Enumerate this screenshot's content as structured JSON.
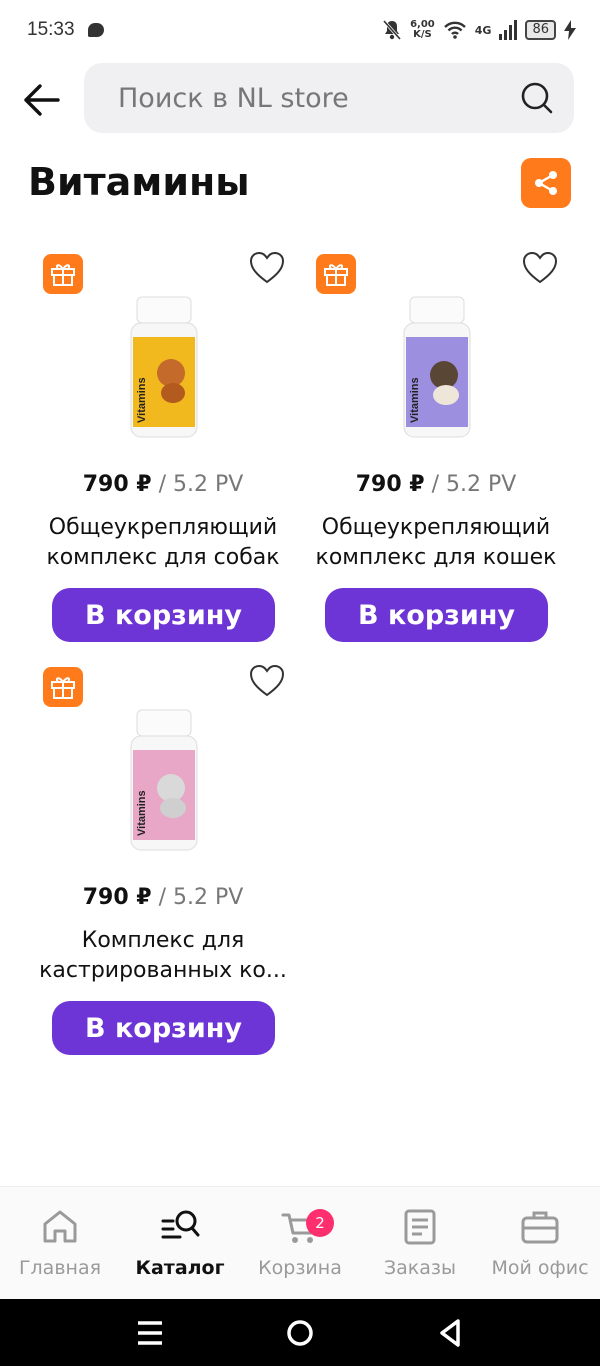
{
  "status_bar": {
    "time": "15:33",
    "net_speed_value": "6,00",
    "net_speed_unit": "K/S",
    "network": "4G",
    "battery": "86"
  },
  "search": {
    "placeholder": "Поиск в NL store"
  },
  "page": {
    "title": "Витамины"
  },
  "accent_colors": {
    "primary_button": "#6d35d6",
    "orange": "#ff7a1a",
    "badge": "#ff2e6e"
  },
  "products": [
    {
      "price": "790 ₽",
      "pv": " / 5.2 PV",
      "name": "Общеукрепляющий комплекс для собак",
      "button": "В корзину",
      "image_label": "Vitamins",
      "image_color": "#f2b91f"
    },
    {
      "price": "790 ₽",
      "pv": " / 5.2 PV",
      "name": "Общеукрепляющий комплекс для кошек",
      "button": "В корзину",
      "image_label": "Vitamins",
      "image_color": "#9c8fe0"
    },
    {
      "price": "790 ₽",
      "pv": " / 5.2 PV",
      "name": "Комплекс для кастрированных ко...",
      "button": "В корзину",
      "image_label": "Vitamins",
      "image_color": "#e8a7c6"
    }
  ],
  "bottom_nav": {
    "items": [
      {
        "label": "Главная",
        "icon": "home-icon"
      },
      {
        "label": "Каталог",
        "icon": "catalog-search-icon"
      },
      {
        "label": "Корзина",
        "icon": "cart-icon"
      },
      {
        "label": "Заказы",
        "icon": "orders-icon"
      },
      {
        "label": "Мой офис",
        "icon": "briefcase-icon"
      }
    ],
    "active": "Каталог",
    "cart_count": "2"
  }
}
